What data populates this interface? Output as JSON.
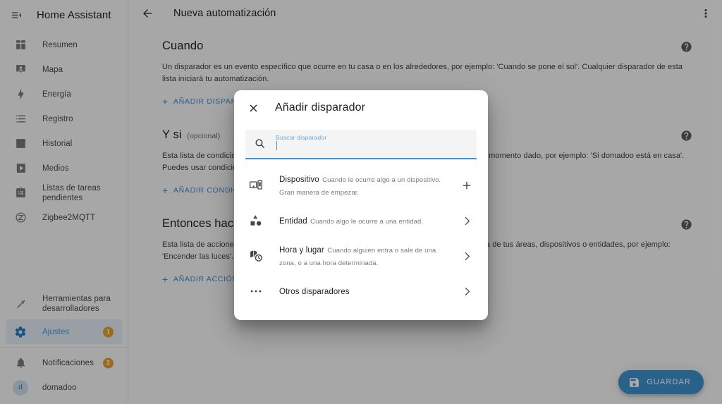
{
  "sidebar": {
    "title": "Home Assistant",
    "menu_icon": "menu-collapse-icon",
    "items": [
      {
        "label": "Resumen",
        "icon": "view-dashboard-icon"
      },
      {
        "label": "Mapa",
        "icon": "map-marker-icon"
      },
      {
        "label": "Energía",
        "icon": "lightning-bolt-icon"
      },
      {
        "label": "Registro",
        "icon": "format-list-icon"
      },
      {
        "label": "Historial",
        "icon": "chart-box-icon"
      },
      {
        "label": "Medios",
        "icon": "play-box-icon"
      },
      {
        "label": "Listas de tareas pendientes",
        "icon": "clipboard-list-icon"
      },
      {
        "label": "Zigbee2MQTT",
        "icon": "zigbee-icon"
      }
    ],
    "tools": {
      "label": "Herramientas para desarrolladores",
      "icon": "hammer-icon"
    },
    "settings": {
      "label": "Ajustes",
      "icon": "cog-icon",
      "badge": "1",
      "selected": true
    },
    "notifications": {
      "label": "Notificaciones",
      "icon": "bell-icon",
      "badge": "2"
    },
    "user": {
      "label": "domadoo",
      "avatar_initial": "d"
    },
    "badge_color": "#e8a02a",
    "accent_color": "#1d7ec2"
  },
  "toolbar": {
    "back_icon": "arrow-left-icon",
    "title": "Nueva automatización",
    "overflow_icon": "dots-vertical-icon"
  },
  "sections": [
    {
      "title": "Cuando",
      "optional_suffix": "",
      "description": "Un disparador es un evento específico que ocurre en tu casa o en los alrededores, por ejemplo: 'Cuando se pone el sol'. Cualquier disparador de esta lista iniciará tu automatización.",
      "add_label": "AÑADIR DISPARADOR",
      "help_icon": "help-circle-icon"
    },
    {
      "title": "Y si",
      "optional_suffix": "(opcional)",
      "description": "Esta lista de condiciones son una serie de comprobaciones que pueden cumplirse o no en un momento dado, por ejemplo: 'Si domadoo está en casa'. Puedes usar condiciones más complejas.",
      "add_label": "AÑADIR CONDICIÓN",
      "help_icon": "help-circle-icon"
    },
    {
      "title": "Entonces hacer",
      "optional_suffix": "",
      "description": "Esta lista de acciones se ejecutarán cuando se active la automatización. Puedes controlar una de tus áreas, dispositivos o entidades, por ejemplo: 'Encender las luces'. Puedes usar acciones más complejas.",
      "add_label": "AÑADIR ACCIÓN",
      "help_icon": "help-circle-icon"
    }
  ],
  "fab": {
    "label": "GUARDAR",
    "icon": "content-save-icon",
    "color": "#3d91cc"
  },
  "dialog": {
    "title": "Añadir disparador",
    "close_icon": "close-icon",
    "search": {
      "label": "Buscar disparador",
      "value": "",
      "placeholder": "Buscar disparador",
      "icon": "search-icon",
      "accent_color": "#4a90c9"
    },
    "items": [
      {
        "primary": "Dispositivo",
        "secondary": "Cuando le ocurre algo a un dispositivo. Gran manera de empezar.",
        "icon": "devices-icon",
        "action_icon": "plus-icon"
      },
      {
        "primary": "Entidad",
        "secondary": "Cuando algo le ocurre a una entidad.",
        "icon": "shape-icon",
        "action_icon": "chevron-right-icon"
      },
      {
        "primary": "Hora y lugar",
        "secondary": "Cuando alguien entra o sale de una zona, o a una hora determinada.",
        "icon": "map-clock-icon",
        "action_icon": "chevron-right-icon"
      },
      {
        "primary": "Otros disparadores",
        "secondary": "",
        "icon": "dots-horizontal-icon",
        "action_icon": "chevron-right-icon"
      }
    ]
  }
}
